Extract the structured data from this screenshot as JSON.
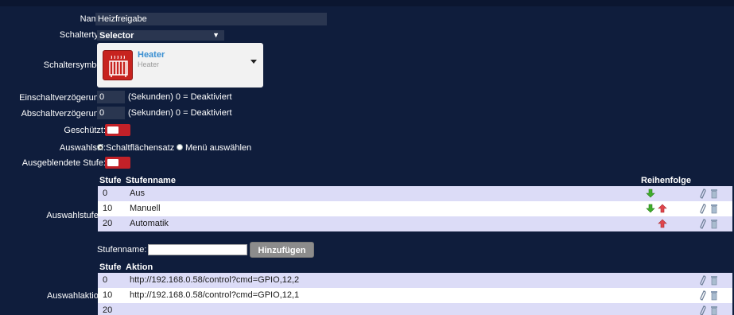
{
  "form": {
    "name_label": "Name:",
    "name_value": "Heizfreigabe",
    "schaltertyp_label": "Schaltertyp:",
    "schaltertyp_value": "Selector",
    "schaltersymbol_label": "Schaltersymbol:",
    "symbol_title": "Heater",
    "symbol_subtitle": "Heater",
    "einschalt_label": "Einschaltverzögerung:",
    "einschalt_value": "0",
    "einschalt_hint": "(Sekunden) 0 = Deaktiviert",
    "abschalt_label": "Abschaltverzögerung:",
    "abschalt_value": "0",
    "abschalt_hint": "(Sekunden) 0 = Deaktiviert",
    "geschuetzt_label": "Geschützt:",
    "auswahlstil_label": "Auswahlstil:",
    "auswahlstil_option1": "Schaltflächensatz",
    "auswahlstil_option2": "Menü auswählen",
    "ausgeblendete_label": "Ausgeblendete Stufe:"
  },
  "levels": {
    "section_label": "Auswahlstufen:",
    "col_stufe": "Stufe",
    "col_name": "Stufenname",
    "col_order": "Reihenfolge",
    "rows": [
      {
        "stufe": "0",
        "name": "Aus"
      },
      {
        "stufe": "10",
        "name": "Manuell"
      },
      {
        "stufe": "20",
        "name": "Automatik"
      }
    ],
    "add_label": "Stufenname:",
    "add_value": "",
    "add_button": "Hinzufügen"
  },
  "actions": {
    "section_label": "Auswahlaktion:",
    "col_stufe": "Stufe",
    "col_action": "Aktion",
    "rows": [
      {
        "stufe": "0",
        "action": "http://192.168.0.58/control?cmd=GPIO,12,2"
      },
      {
        "stufe": "10",
        "action": "http://192.168.0.58/control?cmd=GPIO,12,1"
      },
      {
        "stufe": "20",
        "action": ""
      }
    ]
  },
  "icons": {
    "move_down": "arrow-down-icon",
    "move_up": "arrow-up-icon",
    "edit": "pencil-icon",
    "delete": "trash-icon",
    "symbol": "heater-icon"
  },
  "colors": {
    "background": "#0f1d3c",
    "toggle": "#c22128",
    "row_alt": "#dcdcf7",
    "accent": "#3a8fd1"
  }
}
